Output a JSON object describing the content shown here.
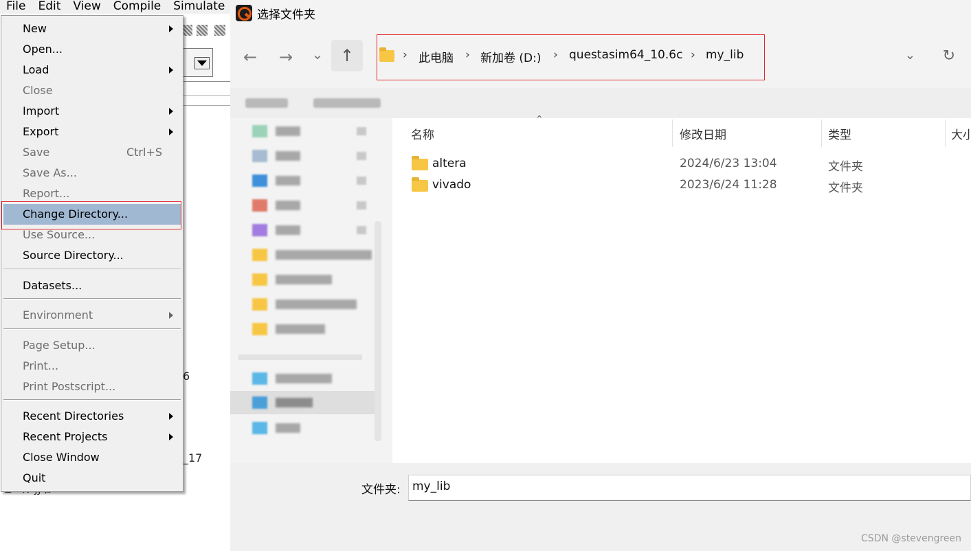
{
  "menubar": {
    "items": [
      "File",
      "Edit",
      "View",
      "Compile",
      "Simulate"
    ]
  },
  "background": {
    "text_fragment_1": "6",
    "text_fragment_2": "_17",
    "text_fragment_3": "± 〈Ɐ ƒƒ ,ℓ    ∙ ¹ ²°"
  },
  "file_menu": {
    "new": "New",
    "open": "Open...",
    "load": "Load",
    "close": "Close",
    "import": "Import",
    "export": "Export",
    "save": "Save",
    "save_shortcut": "Ctrl+S",
    "save_as": "Save As...",
    "report": "Report...",
    "change_directory": "Change Directory...",
    "use_source": "Use Source...",
    "source_directory": "Source Directory...",
    "datasets": "Datasets...",
    "environment": "Environment",
    "page_setup": "Page Setup...",
    "print": "Print...",
    "print_postscript": "Print Postscript...",
    "recent_directories": "Recent Directories",
    "recent_projects": "Recent Projects",
    "close_window": "Close Window",
    "quit": "Quit"
  },
  "dialog": {
    "title": "选择文件夹",
    "nav": {
      "back": "←",
      "forward": "→",
      "recent": "⌄",
      "up": "↑"
    },
    "breadcrumb": [
      "此电脑",
      "新加卷 (D:)",
      "questasim64_10.6c",
      "my_lib"
    ],
    "columns": {
      "name": "名称",
      "modified": "修改日期",
      "type": "类型",
      "size": "大小"
    },
    "files": [
      {
        "name": "altera",
        "modified": "2024/6/23 13:04",
        "type": "文件夹"
      },
      {
        "name": "vivado",
        "modified": "2023/6/24 11:28",
        "type": "文件夹"
      }
    ],
    "folder_label": "文件夹:",
    "folder_value": "my_lib"
  },
  "watermark": "CSDN @stevengreen",
  "colors": {
    "highlight": "#a1b8d3",
    "annotation_red": "#e2292f",
    "folder_yellow": "#f7c645"
  }
}
